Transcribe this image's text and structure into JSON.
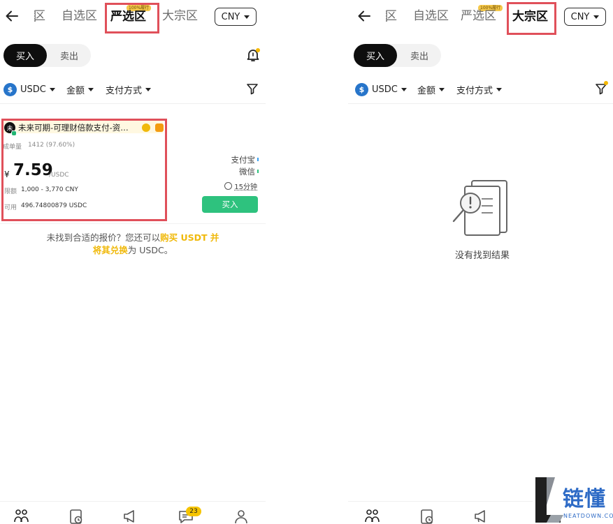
{
  "left": {
    "tabs": [
      {
        "label": "区"
      },
      {
        "label": "自选区"
      },
      {
        "label": "严选区",
        "badge": "100%履行",
        "active": true
      },
      {
        "label": "大宗区"
      }
    ],
    "currency": "CNY",
    "segment": {
      "buy": "买入",
      "sell": "卖出"
    },
    "filters": {
      "coin": "USDC",
      "amount": "金额",
      "payment": "支付方式"
    },
    "ad": {
      "avatar": "未",
      "merchant": "未来可期-可理财倍款支付-资…",
      "trades_label": "成单量",
      "trades_value": "1412 (97.60%)",
      "currency_symbol": "¥",
      "price": "7.59",
      "price_unit": "/USDC",
      "limit_label": "限额",
      "limit_value": "1,000 - 3,770 CNY",
      "available_label": "可用",
      "available_value": "496.74800879 USDC",
      "payments": [
        "支付宝",
        "微信"
      ],
      "time": "15分钟",
      "buy_label": "买入"
    },
    "note": {
      "prefix": "未找到合适的报价？您还可以",
      "link1": "购买 USDT 并",
      "link2": "将其兑换",
      "suffix": "为 USDC。"
    },
    "nav_badge": "23"
  },
  "right": {
    "tabs": [
      {
        "label": "区"
      },
      {
        "label": "自选区"
      },
      {
        "label": "严选区",
        "badge": "100%履行"
      },
      {
        "label": "大宗区",
        "active": true
      }
    ],
    "currency": "CNY",
    "segment": {
      "buy": "买入",
      "sell": "卖出"
    },
    "filters": {
      "coin": "USDC",
      "amount": "金额",
      "payment": "支付方式"
    },
    "empty_text": "没有找到结果"
  },
  "watermark": {
    "title": "链懂",
    "subtitle": "NEATDOWN.COM"
  },
  "colors": {
    "accent_gold": "#f0b90b",
    "buy_green": "#2ec27e",
    "highlight_red": "#e0505a",
    "usdc_blue": "#2775ca"
  },
  "icons": [
    "back-arrow-icon",
    "bell-icon",
    "usdc-coin-icon",
    "filter-icon",
    "clock-icon",
    "p2p-icon",
    "orders-icon",
    "announcement-icon",
    "chat-icon",
    "profile-icon",
    "no-results-icon"
  ]
}
